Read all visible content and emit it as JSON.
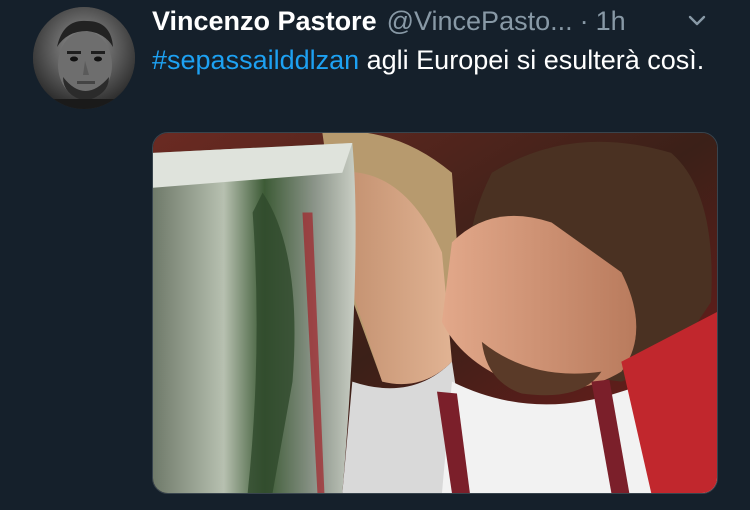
{
  "tweet": {
    "author_name": "Vincenzo Pastore",
    "author_handle": "@VincePasto...",
    "separator": "·",
    "timestamp": "1h",
    "hashtag": "#sepassailddlzan",
    "text_rest": " agli Europei si esulterà così."
  },
  "icons": {
    "more": "chevron-down-icon"
  },
  "colors": {
    "background": "#15202b",
    "hashtag": "#1da1f2",
    "secondary_text": "#8899a6",
    "primary_text": "#ffffff"
  }
}
